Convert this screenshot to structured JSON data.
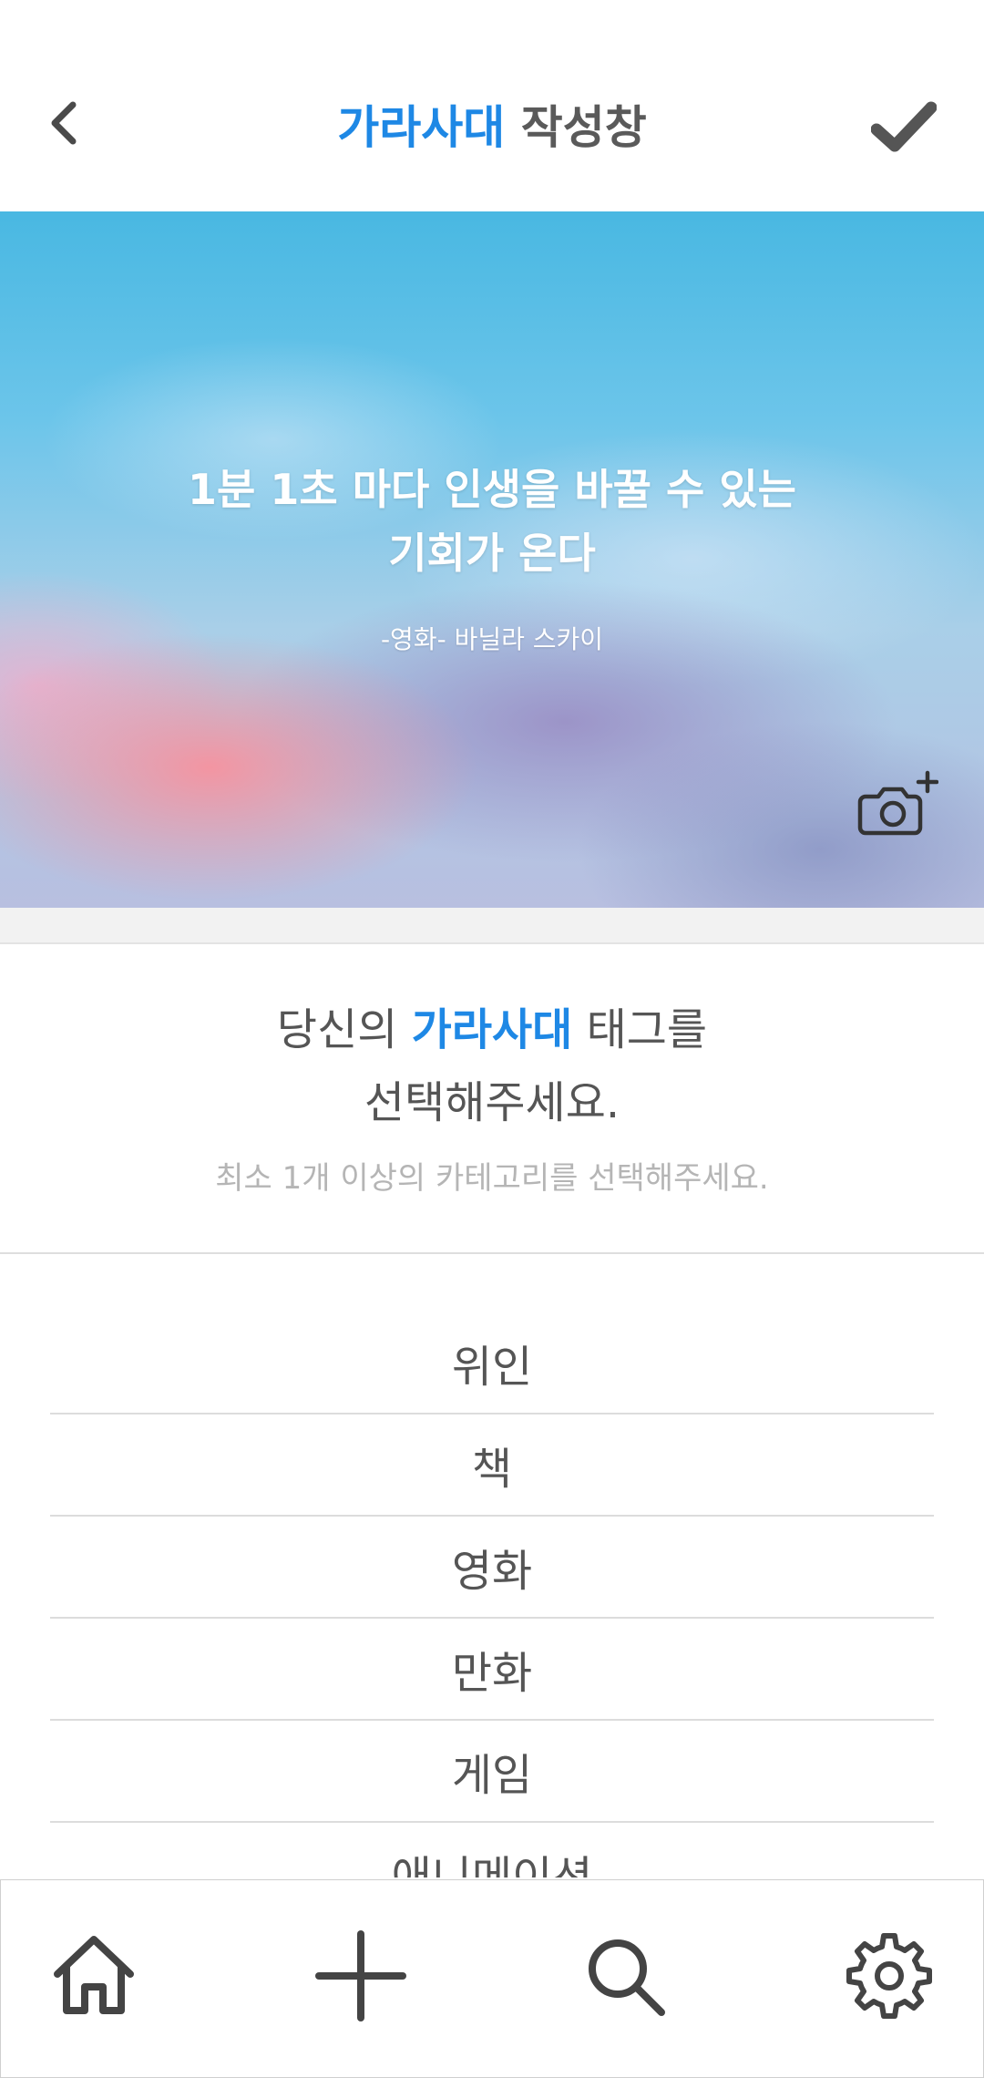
{
  "header": {
    "title_accent": "가라사대",
    "title_rest": " 작성창",
    "back_icon": "chevron-left-icon",
    "confirm_icon": "checkmark-icon"
  },
  "banner": {
    "quote_line1": "1분 1초 마다 인생을 바꿀 수 있는",
    "quote_line2": "기회가 온다",
    "source": "-영화- 바닐라 스카이",
    "camera_icon": "camera-add-icon"
  },
  "prompt": {
    "before": "당신의 ",
    "accent": "가라사대",
    "after": " 태그를",
    "line2": "선택해주세요.",
    "hint": "최소 1개 이상의 카테고리를 선택해주세요."
  },
  "categories": [
    {
      "label": "위인"
    },
    {
      "label": "책"
    },
    {
      "label": "영화"
    },
    {
      "label": "만화"
    },
    {
      "label": "게임"
    },
    {
      "label": "애니메이션"
    }
  ],
  "tabbar": {
    "items": [
      {
        "icon": "home-icon"
      },
      {
        "icon": "plus-icon"
      },
      {
        "icon": "search-icon"
      },
      {
        "icon": "settings-gear-icon"
      }
    ]
  },
  "colors": {
    "accent": "#1e88e5",
    "text": "#555555",
    "hint": "#b5b5b5"
  }
}
